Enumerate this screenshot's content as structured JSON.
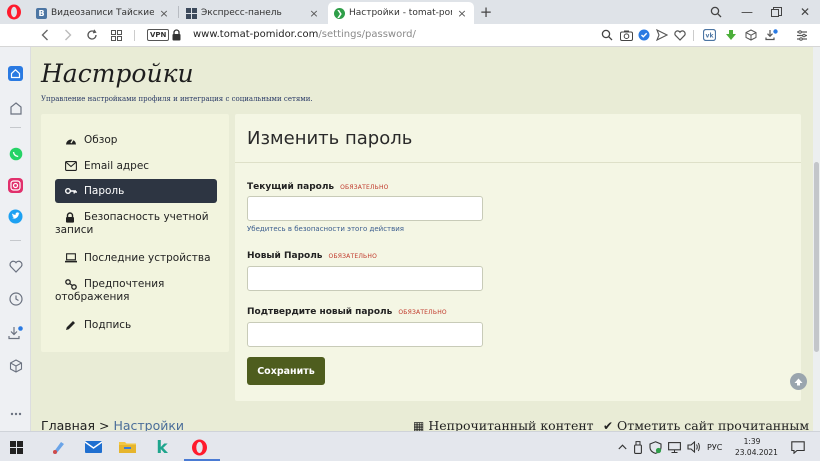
{
  "browser": {
    "tabs": [
      {
        "title": "Видеозаписи Тайские Лай",
        "favicon": "vk-icon",
        "active": false
      },
      {
        "title": "Экспресс-панель",
        "favicon": "speed-dial-icon",
        "active": false
      },
      {
        "title": "Настройки - tomat-pomido",
        "favicon": "tomat-pomidor-icon",
        "active": true
      }
    ],
    "vpn_label": "VPN",
    "url_host": "www.tomat-pomidor.com",
    "url_path": "/settings/password/",
    "accent": "#ff1b2d"
  },
  "page": {
    "title": "Настройки",
    "subtitle": "Управление настройками профиля и интеграция с социальными сетями."
  },
  "nav": {
    "items": [
      {
        "label": "Обзор",
        "icon": "dashboard-icon"
      },
      {
        "label": "Email адрес",
        "icon": "envelope-icon"
      },
      {
        "label": "Пароль",
        "icon": "key-icon",
        "active": true
      },
      {
        "label": "Безопасность учетной записи",
        "icon": "lock-icon"
      },
      {
        "label": "Последние устройства",
        "icon": "laptop-icon"
      },
      {
        "label": "Предпочтения отображения",
        "icon": "link-icon"
      },
      {
        "label": "Подпись",
        "icon": "pen-icon"
      }
    ]
  },
  "form": {
    "title": "Изменить пароль",
    "required_tag": "ОБЯЗАТЕЛЬНО",
    "current_label": "Текущий пароль",
    "current_value": "",
    "current_hint": "Убедитесь в безопасности этого действия",
    "new_label": "Новый Пароль",
    "new_value": "",
    "confirm_label": "Подтвердите новый пароль",
    "confirm_value": "",
    "save_label": "Сохранить"
  },
  "footer": {
    "home": "Главная",
    "separator": ">",
    "current": "Настройки",
    "unread": "Непрочитанный контент",
    "mark_read": "Отметить сайт прочитанным"
  },
  "taskbar": {
    "language": "РУС",
    "time": "1:39",
    "date": "23.04.2021"
  }
}
